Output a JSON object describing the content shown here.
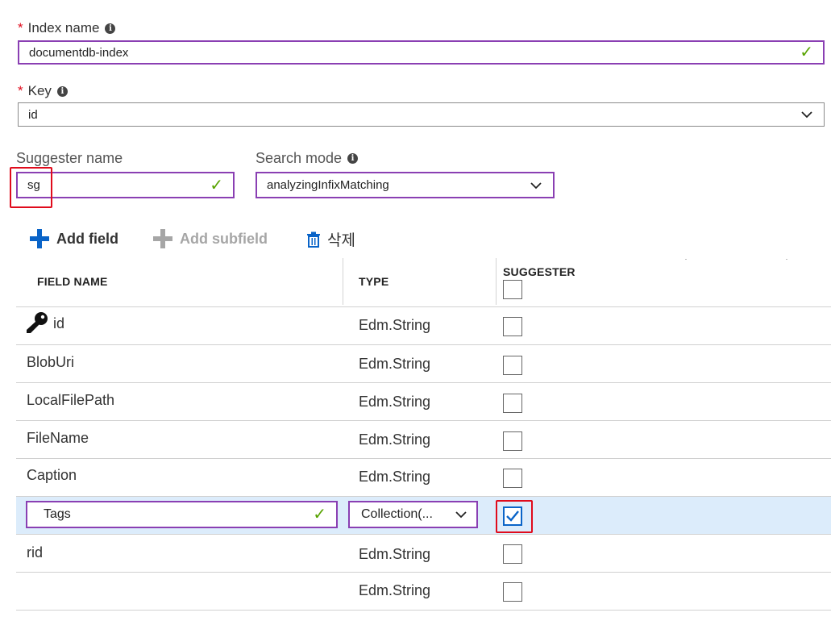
{
  "index_name": {
    "label": "Index name",
    "value": "documentdb-index",
    "required": "*"
  },
  "key": {
    "label": "Key",
    "value": "id",
    "required": "*"
  },
  "suggester_name": {
    "label": "Suggester name",
    "value": "sg"
  },
  "search_mode": {
    "label": "Search mode",
    "value": "analyzingInfixMatching"
  },
  "toolbar": {
    "add_field": "Add field",
    "add_subfield": "Add subfield",
    "delete": "삭제"
  },
  "table": {
    "headers": {
      "field_name": "FIELD NAME",
      "type": "TYPE",
      "suggester": "SUGGESTER"
    },
    "rows": [
      {
        "name": "id",
        "type": "Edm.String",
        "suggester": false,
        "is_key": true
      },
      {
        "name": "BlobUri",
        "type": "Edm.String",
        "suggester": false
      },
      {
        "name": "LocalFilePath",
        "type": "Edm.String",
        "suggester": false
      },
      {
        "name": "FileName",
        "type": "Edm.String",
        "suggester": false
      },
      {
        "name": "Caption",
        "type": "Edm.String",
        "suggester": false
      },
      {
        "name": "Tags",
        "type": "Collection(...",
        "suggester": true,
        "selected": true
      },
      {
        "name": "rid",
        "type": "Edm.String",
        "suggester": false
      },
      {
        "name": "",
        "type": "Edm.String",
        "suggester": false
      }
    ]
  },
  "colors": {
    "required_star": "#e00b1c",
    "valid_check": "#57a300",
    "focus_border": "#8a3fb3",
    "highlight_box": "#e00b1c",
    "selected_row": "#dcecfb",
    "primary_blue": "#0a64c8"
  }
}
